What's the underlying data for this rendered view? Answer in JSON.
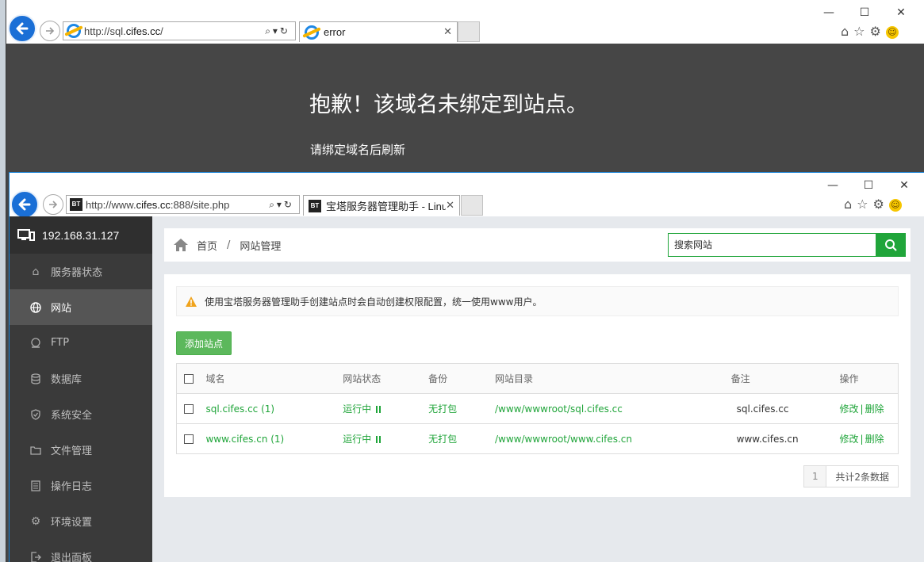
{
  "back_window": {
    "url_prefix": "http://sql.",
    "url_domain": "cifes.cc",
    "url_suffix": "/",
    "tab_title": "error",
    "error_title": "抱歉！该域名未绑定到站点。",
    "error_subtitle": "请绑定域名后刷新"
  },
  "front_window": {
    "url_prefix": "http://www.",
    "url_domain": "cifes.cc",
    "url_suffix": ":888/site.php",
    "tab_title": "宝塔服务器管理助手 - Linu..."
  },
  "window_controls": {
    "minimize": "—",
    "maximize": "☐",
    "close": "✕"
  },
  "sidebar": {
    "ip": "192.168.31.127",
    "items": [
      {
        "label": "服务器状态",
        "icon": "home-icon"
      },
      {
        "label": "网站",
        "icon": "globe-icon",
        "active": true
      },
      {
        "label": "FTP",
        "icon": "ftp-icon"
      },
      {
        "label": "数据库",
        "icon": "database-icon"
      },
      {
        "label": "系统安全",
        "icon": "shield-icon"
      },
      {
        "label": "文件管理",
        "icon": "folder-icon"
      },
      {
        "label": "操作日志",
        "icon": "log-icon"
      },
      {
        "label": "环境设置",
        "icon": "gear-icon"
      },
      {
        "label": "退出面板",
        "icon": "logout-icon"
      }
    ]
  },
  "breadcrumb": {
    "home": "首页",
    "separator": "/",
    "current": "网站管理"
  },
  "search": {
    "placeholder": "搜索网站"
  },
  "alert": {
    "text": "使用宝塔服务器管理助手创建站点时会自动创建权限配置，统一使用www用户。"
  },
  "add_button": "添加站点",
  "table": {
    "headers": [
      "域名",
      "网站状态",
      "备份",
      "网站目录",
      "备注",
      "操作"
    ],
    "rows": [
      {
        "domain": "sql.cifes.cc (1)",
        "status": "运行中",
        "backup": "无打包",
        "dir": "/www/wwwroot/sql.cifes.cc",
        "note": "sql.cifes.cc",
        "edit": "修改",
        "delete": "删除"
      },
      {
        "domain": "www.cifes.cn (1)",
        "status": "运行中",
        "backup": "无打包",
        "dir": "/www/wwwroot/www.cifes.cn",
        "note": "www.cifes.cn",
        "edit": "修改",
        "delete": "删除"
      }
    ],
    "op_separator": "|"
  },
  "pagination": {
    "page": "1",
    "total": "共计2条数据"
  },
  "colors": {
    "accent": "#20a53a",
    "sidebar": "#3a3a3a",
    "back_bg": "#464646"
  }
}
